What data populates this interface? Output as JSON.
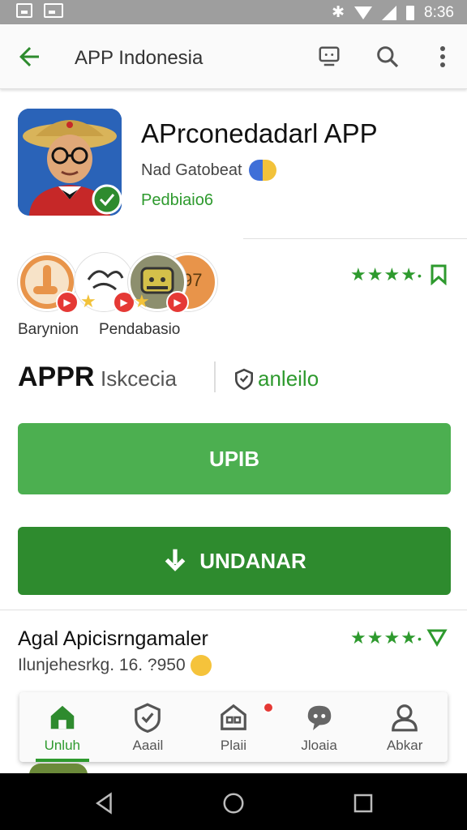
{
  "status_bar": {
    "time": "8:36",
    "icons": [
      "screenshot-icon",
      "image-icon",
      "bluetooth-icon",
      "wifi-icon",
      "signal-icon",
      "battery-icon"
    ]
  },
  "toolbar": {
    "title": "APP Indonesia",
    "icons": [
      "back-arrow-icon",
      "tv-icon",
      "search-icon",
      "more-vert-icon"
    ]
  },
  "app": {
    "title": "APrconedadarl APP",
    "developer": "Nad Gatobeat",
    "category": "Pedbiaio6",
    "icon": "app-avatar-icon"
  },
  "reviewers": {
    "labels": [
      "Barynion",
      "Pendabasio"
    ],
    "badge_number": "97",
    "rating_icons": [
      "star-icon",
      "star-icon",
      "star-icon",
      "star-icon"
    ],
    "bookmark_icon": "bookmark-icon"
  },
  "stats": {
    "primary": "APPR",
    "secondary": "Iskcecia",
    "right_label": "anleilo",
    "right_icon": "shield-icon"
  },
  "buttons": {
    "update_label": "UPIB",
    "install_label": "UNDANAR",
    "install_icon": "download-icon"
  },
  "info": {
    "title": "Agal Apicisrngamaler",
    "subtitle": "Ilunjehesrkg. 16. ?950",
    "emoji_icon": "emoji-icon",
    "rating_icons": [
      "star-icon",
      "star-icon",
      "star-icon",
      "star-icon"
    ],
    "heart_icon": "heart-icon"
  },
  "bottom_nav": {
    "items": [
      {
        "label": "Unluh",
        "icon": "home-icon",
        "active": true
      },
      {
        "label": "Aaail",
        "icon": "shield-check-icon",
        "active": false
      },
      {
        "label": "Plaii",
        "icon": "store-icon",
        "active": false
      },
      {
        "label": "Jloaia",
        "icon": "chat-icon",
        "active": false
      },
      {
        "label": "Abkar",
        "icon": "person-icon",
        "active": false
      }
    ]
  },
  "system_nav": {
    "icons": [
      "back-triangle-icon",
      "home-circle-icon",
      "recents-square-icon"
    ]
  },
  "colors": {
    "accent": "#4caf50",
    "accent_dark": "#2e8b2e",
    "text_green": "#2e9a2e",
    "status_bar": "#9e9e9e"
  }
}
